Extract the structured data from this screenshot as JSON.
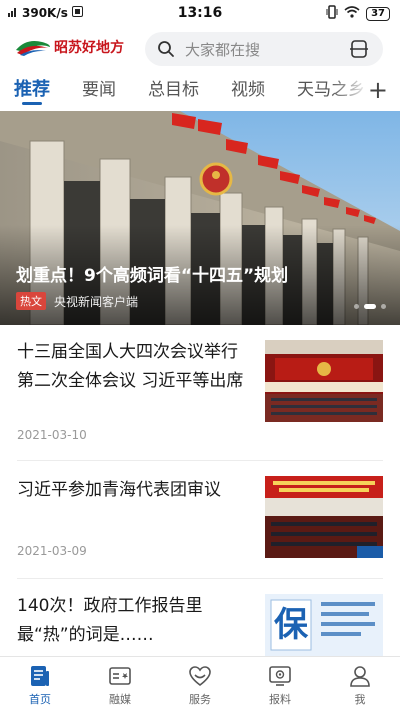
{
  "status_bar": {
    "speed": "390K/s",
    "time": "13:16",
    "battery": "37"
  },
  "header": {
    "logo_text": "昭苏好地方",
    "search_placeholder": "大家都在搜"
  },
  "tabs": [
    {
      "label": "推荐",
      "active": true
    },
    {
      "label": "要闻",
      "active": false
    },
    {
      "label": "总目标",
      "active": false
    },
    {
      "label": "视频",
      "active": false
    },
    {
      "label": "天马之乡",
      "active": false
    }
  ],
  "add_tab_label": "+",
  "hero": {
    "title": "划重点！9个高频词看“十四五”规划",
    "tag": "热文",
    "source": "央视新闻客户端"
  },
  "news": [
    {
      "title": "十三届全国人大四次会议举行第二次全体会议 习近平等出席",
      "date": "2021-03-10"
    },
    {
      "title": "习近平参加青海代表团审议",
      "date": "2021-03-09"
    },
    {
      "title": "140次！政府工作报告里最“热”的词是……",
      "date": ""
    }
  ],
  "bottom_nav": [
    {
      "label": "首页",
      "icon": "home-icon",
      "active": true
    },
    {
      "label": "融媒",
      "icon": "media-icon",
      "active": false
    },
    {
      "label": "服务",
      "icon": "service-icon",
      "active": false
    },
    {
      "label": "报料",
      "icon": "report-icon",
      "active": false
    },
    {
      "label": "我",
      "icon": "profile-icon",
      "active": false
    }
  ],
  "colors": {
    "accent": "#1b62b3",
    "brand_red": "#c8161d",
    "hot_tag": "#d9463c"
  }
}
